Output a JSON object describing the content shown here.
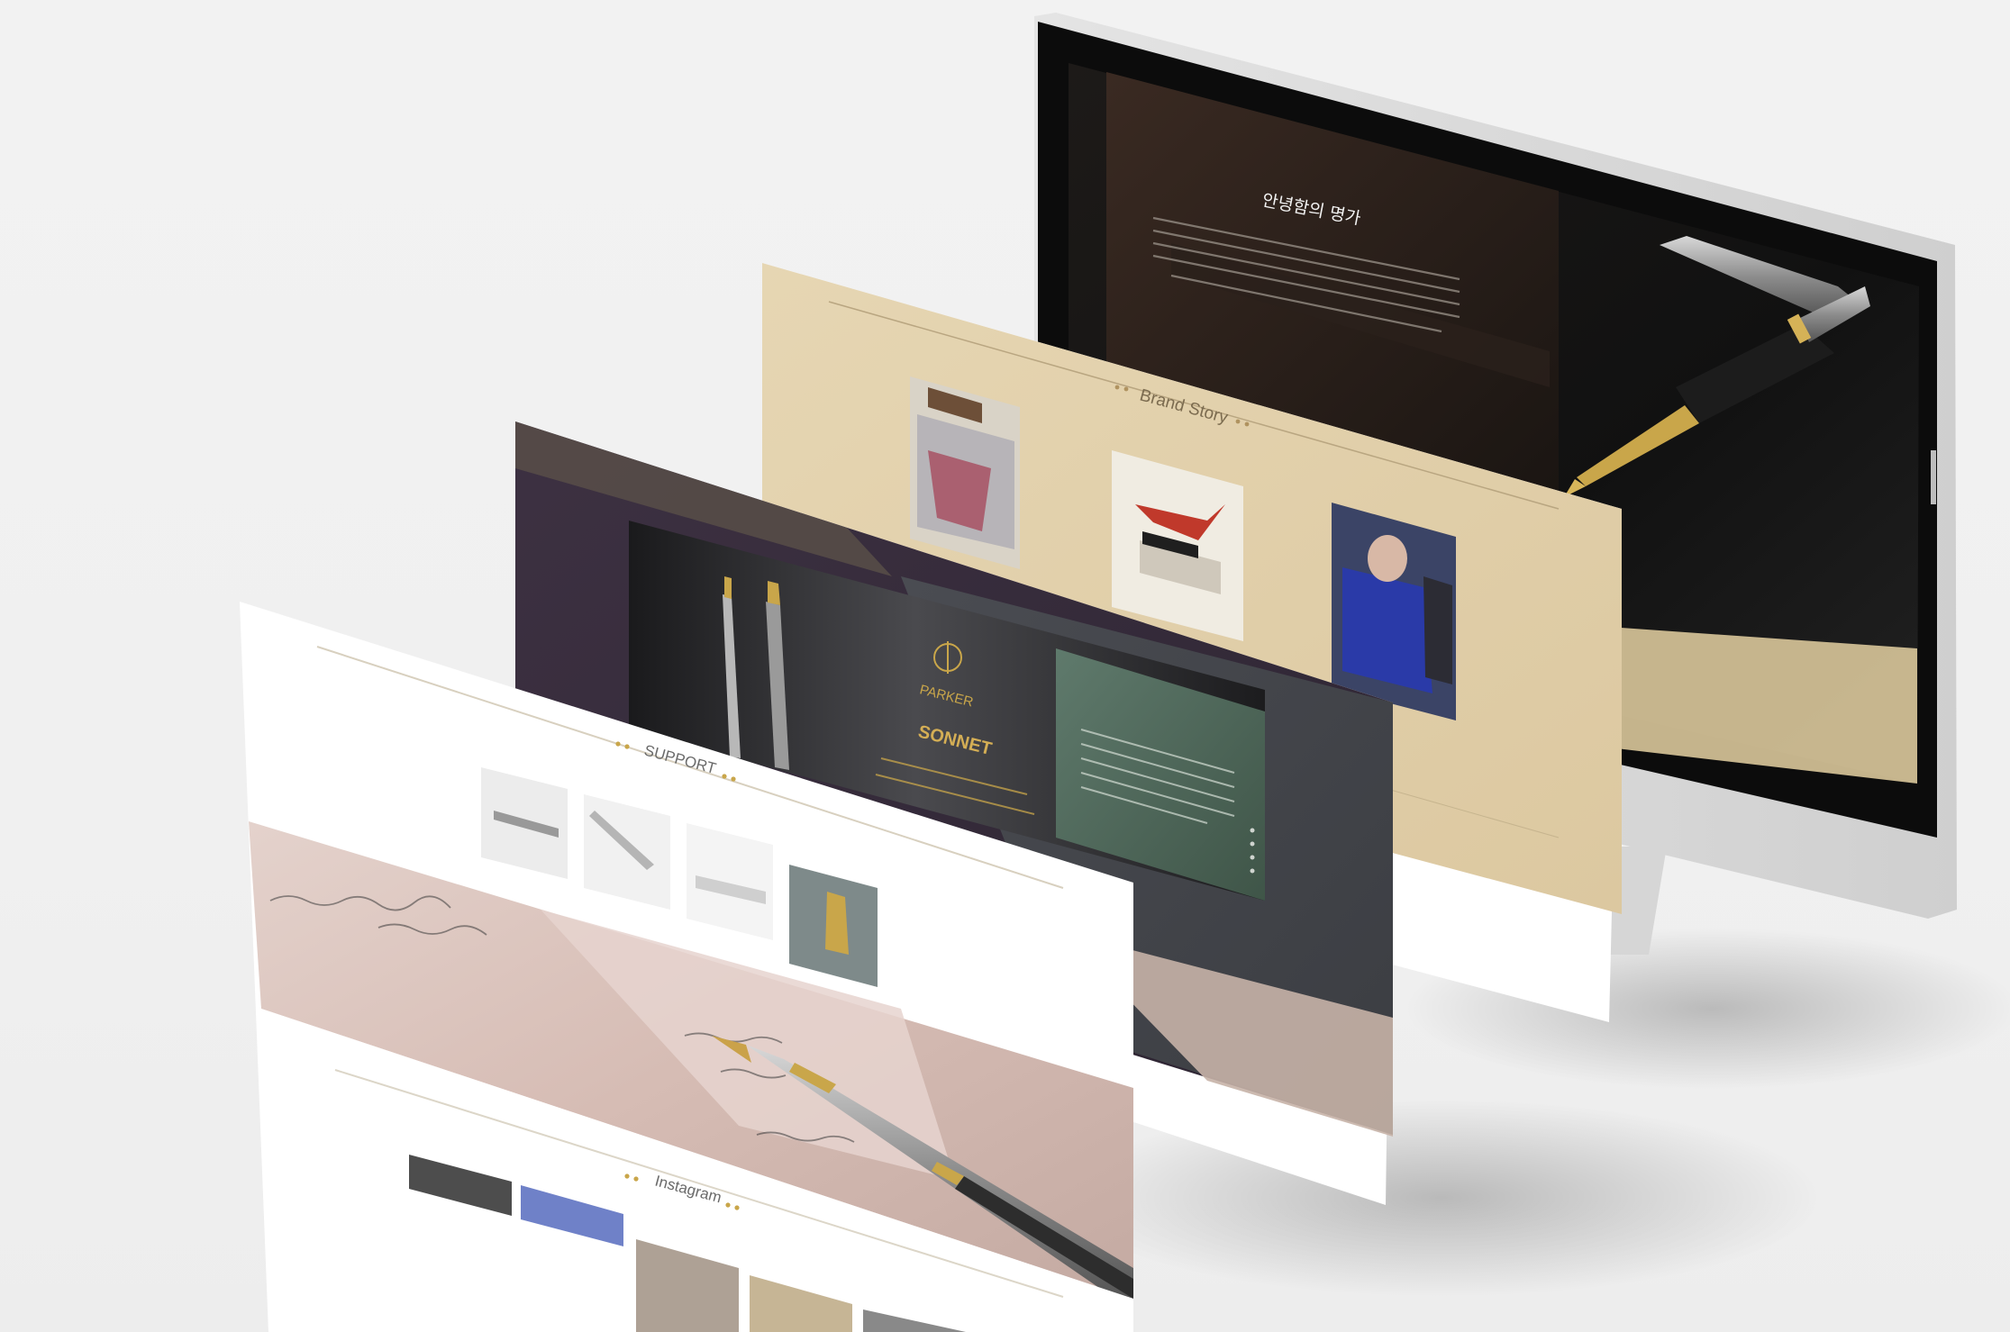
{
  "monitor": {
    "heading": "안녕함의 명가"
  },
  "brand_story": {
    "title": "Brand Story"
  },
  "sonnet": {
    "brand": "PARKER",
    "title": "SONNET"
  },
  "support": {
    "title": "SUPPORT"
  },
  "instagram": {
    "title": "Instagram"
  },
  "colors": {
    "background": "#f0f0f0",
    "gold_accent": "#c9a64a",
    "beige_panel": "#e0cfaa",
    "purple_panel": "#3a2e3f",
    "monitor_screen": "#121212"
  }
}
